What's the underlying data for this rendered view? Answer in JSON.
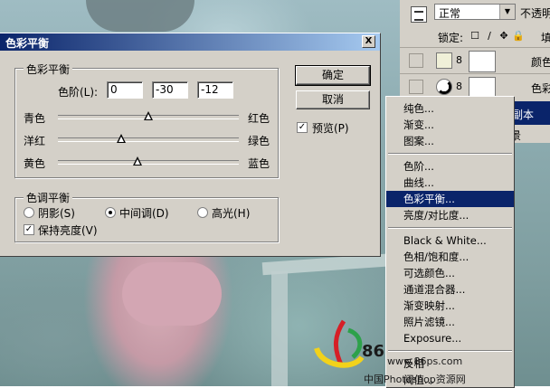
{
  "dialog": {
    "title": "色彩平衡",
    "close_glyph": "X",
    "balance_group": "色彩平衡",
    "levels_label": "色阶(L):",
    "levels": [
      "0",
      "-30",
      "-12"
    ],
    "sliders": [
      {
        "left": "青色",
        "right": "红色",
        "value": 0
      },
      {
        "left": "洋红",
        "right": "绿色",
        "value": -30
      },
      {
        "left": "黄色",
        "right": "蓝色",
        "value": -12
      }
    ],
    "tone_group": "色调平衡",
    "tones": [
      {
        "label": "阴影(S)",
        "checked": false
      },
      {
        "label": "中间调(D)",
        "checked": true
      },
      {
        "label": "高光(H)",
        "checked": false
      }
    ],
    "preserve_luminosity": "保持亮度(V)",
    "ok": "确定",
    "cancel": "取消",
    "preview": "预览(P)",
    "checkmark": "✓"
  },
  "layers_panel": {
    "blend_mode": "正常",
    "opacity_label": "不透明",
    "lock_label": "锁定:",
    "lock_icons": [
      "☐",
      "∕",
      "✥",
      "🔒"
    ],
    "fill_label": "填",
    "rows": [
      {
        "name": "颜色",
        "thumb": "solid"
      },
      {
        "name": "色彩",
        "thumb": "adjustment"
      }
    ],
    "selected_layer": "副本",
    "bottom_text": "景"
  },
  "context_menu": {
    "items": [
      {
        "label": "纯色...",
        "group": 1
      },
      {
        "label": "渐变...",
        "group": 1
      },
      {
        "label": "图案...",
        "group": 1
      },
      {
        "label": "色阶...",
        "group": 2
      },
      {
        "label": "曲线...",
        "group": 2
      },
      {
        "label": "色彩平衡...",
        "group": 2,
        "selected": true
      },
      {
        "label": "亮度/对比度...",
        "group": 2
      },
      {
        "label": "Black & White...",
        "group": 3
      },
      {
        "label": "色相/饱和度...",
        "group": 3
      },
      {
        "label": "可选颜色...",
        "group": 3
      },
      {
        "label": "通道混合器...",
        "group": 3
      },
      {
        "label": "渐变映射...",
        "group": 3
      },
      {
        "label": "照片滤镜...",
        "group": 3
      },
      {
        "label": "Exposure...",
        "group": 3
      },
      {
        "label": "反相",
        "group": 4
      },
      {
        "label": "阈值...",
        "group": 4
      }
    ]
  },
  "watermark": {
    "number": "86",
    "url": "www.86ps.com",
    "site": "中国Photoshop资源网"
  },
  "colors": {
    "selection": "#0a246a",
    "chrome": "#d4d0c8"
  }
}
